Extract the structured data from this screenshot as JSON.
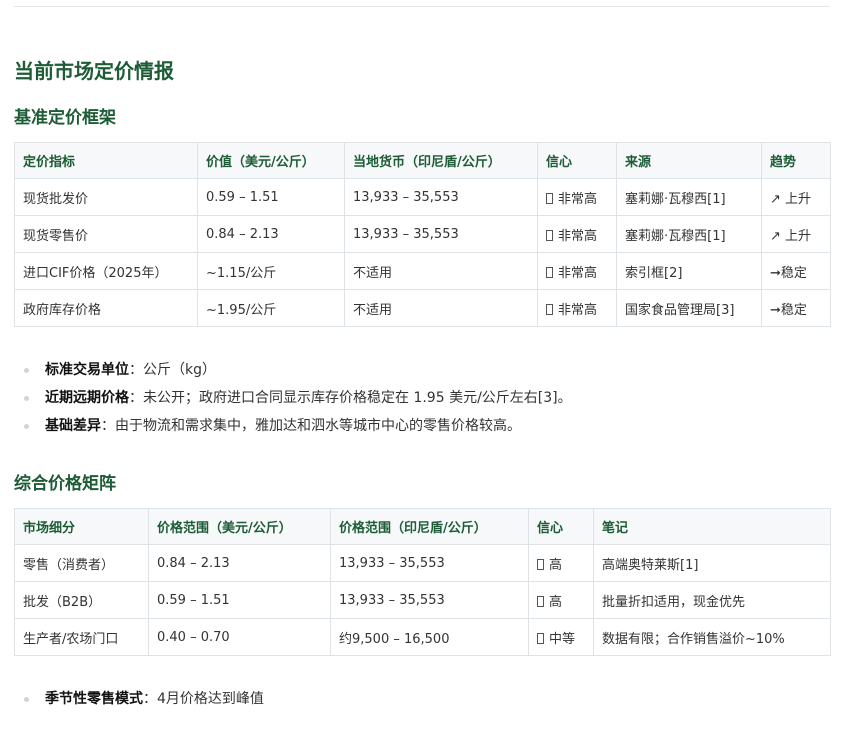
{
  "heading_main": "当前市场定价情报",
  "section1": {
    "heading": "基准定价框架",
    "columns": [
      "定价指标",
      "价值（美元/公斤）",
      "当地货币（印尼盾/公斤）",
      "信心",
      "来源",
      "趋势"
    ],
    "rows": [
      {
        "metric": "现货批发价",
        "usd": "0.59 – 1.51",
        "idr": "13,933 – 35,553",
        "confidence": "非常高",
        "source": "塞莉娜·瓦穆西[1]",
        "trend": "↗ 上升"
      },
      {
        "metric": "现货零售价",
        "usd": "0.84 – 2.13",
        "idr": "13,933 – 35,553",
        "confidence": "非常高",
        "source": "塞莉娜·瓦穆西[1]",
        "trend": "↗ 上升"
      },
      {
        "metric": "进口CIF价格（2025年）",
        "usd": "~1.15/公斤",
        "idr": "不适用",
        "confidence": "非常高",
        "source": "索引框[2]",
        "trend": "➞稳定"
      },
      {
        "metric": "政府库存价格",
        "usd": "~1.95/公斤",
        "idr": "不适用",
        "confidence": "非常高",
        "source": "国家食品管理局[3]",
        "trend": "➞稳定"
      }
    ]
  },
  "bullets1": [
    {
      "label": "标准交易单位",
      "text": "：公斤（kg）"
    },
    {
      "label": "近期远期价格",
      "text": "：未公开；政府进口合同显示库存价格稳定在 1.95 美元/公斤左右[3]。"
    },
    {
      "label": "基础差异",
      "text": "：由于物流和需求集中，雅加达和泗水等城市中心的零售价格较高。"
    }
  ],
  "section2": {
    "heading": "综合价格矩阵",
    "columns": [
      "市场细分",
      "价格范围（美元/公斤）",
      "价格范围（印尼盾/公斤）",
      "信心",
      "笔记"
    ],
    "rows": [
      {
        "segment": "零售（消费者）",
        "usd": "0.84 – 2.13",
        "idr": "13,933 – 35,553",
        "confidence": "高",
        "note": "高端奥特莱斯[1]"
      },
      {
        "segment": "批发（B2B）",
        "usd": "0.59 – 1.51",
        "idr": "13,933 – 35,553",
        "confidence": "高",
        "note": "批量折扣适用，现金优先"
      },
      {
        "segment": "生产者/农场门口",
        "usd": "0.40 – 0.70",
        "idr": "约9,500 – 16,500",
        "confidence": "中等",
        "note": "数据有限；合作销售溢价~10%"
      }
    ]
  },
  "bullets2": [
    {
      "label": "季节性零售模式",
      "text": "：4月价格达到峰值"
    }
  ]
}
